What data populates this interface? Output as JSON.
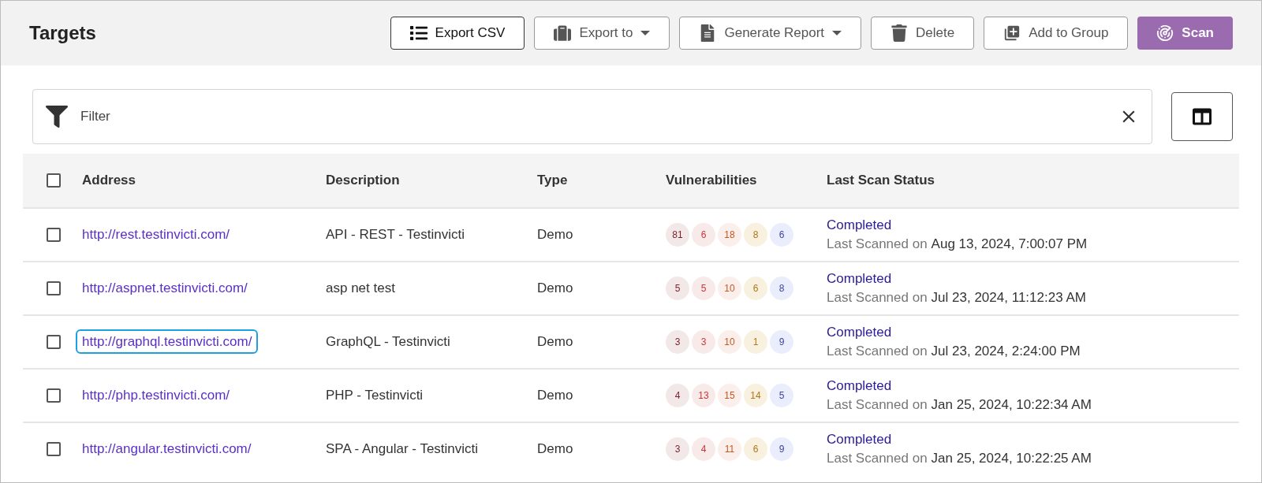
{
  "page": {
    "title": "Targets"
  },
  "toolbar": [
    {
      "label": "Export CSV",
      "kind": "list",
      "dropdown": false,
      "primary": false
    },
    {
      "label": "Export to",
      "kind": "export",
      "dropdown": true,
      "primary": false
    },
    {
      "label": "Generate Report",
      "kind": "report",
      "dropdown": true,
      "primary": false
    },
    {
      "label": "Delete",
      "kind": "delete",
      "dropdown": false,
      "primary": false
    },
    {
      "label": "Add to Group",
      "kind": "add",
      "dropdown": false,
      "primary": false
    },
    {
      "label": "Scan",
      "kind": "scan",
      "dropdown": false,
      "primary": true
    }
  ],
  "filter": {
    "placeholder": "Filter"
  },
  "table": {
    "select_all": {
      "checked": false
    },
    "columns": [
      "Address",
      "Description",
      "Type",
      "Vulnerabilities",
      "Last Scan Status"
    ],
    "rows": [
      {
        "checked": false,
        "address": "http://rest.testinvicti.com/",
        "focused": false,
        "description": "API - REST - Testinvicti",
        "type": "Demo",
        "vulnerabilities": [
          {
            "count": "81",
            "kind": "critical"
          },
          {
            "count": "6",
            "kind": "high"
          },
          {
            "count": "18",
            "kind": "medium"
          },
          {
            "count": "8",
            "kind": "low"
          },
          {
            "count": "6",
            "kind": "info"
          }
        ],
        "status": "Completed",
        "scanned_label": "Last Scanned on",
        "scanned_at": "Aug 13, 2024, 7:00:07 PM"
      },
      {
        "checked": false,
        "address": "http://aspnet.testinvicti.com/",
        "focused": false,
        "description": "asp net test",
        "type": "Demo",
        "vulnerabilities": [
          {
            "count": "5",
            "kind": "critical"
          },
          {
            "count": "5",
            "kind": "high"
          },
          {
            "count": "10",
            "kind": "medium"
          },
          {
            "count": "6",
            "kind": "low"
          },
          {
            "count": "8",
            "kind": "info"
          }
        ],
        "status": "Completed",
        "scanned_label": "Last Scanned on",
        "scanned_at": "Jul 23, 2024, 11:12:23 AM"
      },
      {
        "checked": false,
        "address": "http://graphql.testinvicti.com/",
        "focused": true,
        "description": "GraphQL - Testinvicti",
        "type": "Demo",
        "vulnerabilities": [
          {
            "count": "3",
            "kind": "critical"
          },
          {
            "count": "3",
            "kind": "high"
          },
          {
            "count": "10",
            "kind": "medium"
          },
          {
            "count": "1",
            "kind": "low"
          },
          {
            "count": "9",
            "kind": "info"
          }
        ],
        "status": "Completed",
        "scanned_label": "Last Scanned on",
        "scanned_at": "Jul 23, 2024, 2:24:00 PM"
      },
      {
        "checked": false,
        "address": "http://php.testinvicti.com/",
        "focused": false,
        "description": "PHP - Testinvicti",
        "type": "Demo",
        "vulnerabilities": [
          {
            "count": "4",
            "kind": "critical"
          },
          {
            "count": "13",
            "kind": "high"
          },
          {
            "count": "15",
            "kind": "medium"
          },
          {
            "count": "14",
            "kind": "low"
          },
          {
            "count": "5",
            "kind": "info"
          }
        ],
        "status": "Completed",
        "scanned_label": "Last Scanned on",
        "scanned_at": "Jan 25, 2024, 10:22:34 AM"
      },
      {
        "checked": false,
        "address": "http://angular.testinvicti.com/",
        "focused": false,
        "description": "SPA - Angular - Testinvicti",
        "type": "Demo",
        "vulnerabilities": [
          {
            "count": "3",
            "kind": "critical"
          },
          {
            "count": "4",
            "kind": "high"
          },
          {
            "count": "11",
            "kind": "medium"
          },
          {
            "count": "6",
            "kind": "low"
          },
          {
            "count": "9",
            "kind": "info"
          }
        ],
        "status": "Completed",
        "scanned_label": "Last Scanned on",
        "scanned_at": "Jan 25, 2024, 10:22:25 AM"
      }
    ]
  }
}
